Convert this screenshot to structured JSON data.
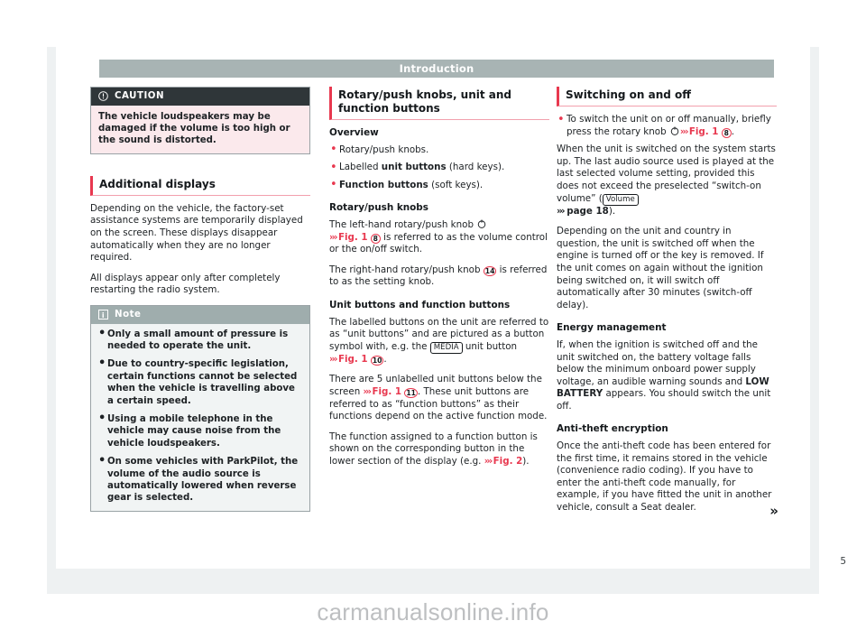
{
  "page": {
    "header_title": "Introduction",
    "page_number": "5",
    "watermark": "carmanualsonline.info"
  },
  "column_left": {
    "caution": {
      "icon": "exclamation-circle-icon",
      "label": "CAUTION",
      "text": "The vehicle loudspeakers may be damaged if the volume is too high or the sound is distorted."
    },
    "section": {
      "heading": "Additional displays",
      "paragraph_1": "Depending on the vehicle, the factory-set assistance systems are temporarily displayed on the screen. These displays disappear automatically when they are no longer required.",
      "paragraph_2": "All displays appear only after completely restarting the radio system."
    },
    "note": {
      "icon": "info-icon",
      "label": "Note",
      "items": [
        "Only a small amount of pressure is needed to operate the unit.",
        "Due to country-specific legislation, certain functions cannot be selected when the vehicle is travelling above a certain speed.",
        "Using a mobile telephone in the vehicle may cause noise from the vehicle loudspeakers.",
        "On some vehicles with ParkPilot, the volume of the audio source is automatically lowered when reverse gear is selected."
      ]
    }
  },
  "column_middle": {
    "heading": "Rotary/push knobs, unit and function buttons",
    "overview": {
      "subheading": "Overview",
      "bullet_1": "Rotary/push knobs.",
      "bullet_2_pre": "Labelled ",
      "bullet_2_bold": "unit buttons",
      "bullet_2_post": " (hard keys).",
      "bullet_3_bold": "Function buttons",
      "bullet_3_post": " (soft keys)."
    },
    "knobs": {
      "subheading": "Rotary/push knobs",
      "p1_a": "The left-hand rotary/push knob ",
      "p1_icon": "rotary-knob-icon",
      "p1_ref": "Fig. 1",
      "p1_callout": "8",
      "p1_b": " is referred to as the volume control or the on/off switch.",
      "p2_a": "The right-hand rotary/push knob ",
      "p2_callout": "14",
      "p2_b": " is referred to as the setting knob."
    },
    "buttons": {
      "subheading": "Unit buttons and function buttons",
      "p1_a": "The labelled buttons on the unit are referred to as “unit buttons” and are pictured as a button symbol with, e.g. the ",
      "p1_key": "MEDIA",
      "p1_b": " unit button ",
      "p1_ref": "Fig. 1",
      "p1_callout": "10",
      "p1_c": ".",
      "p2_a": "There are 5 unlabelled unit buttons below the screen ",
      "p2_ref": "Fig. 1",
      "p2_callout": "11",
      "p2_b": ". These unit buttons are referred to as “function buttons” as their functions depend on the active function mode.",
      "p3_a": "The function assigned to a function button is shown on the corresponding button in the lower section of the display (e.g. ",
      "p3_ref": "Fig. 2",
      "p3_b": ")."
    }
  },
  "column_right": {
    "heading": "Switching on and off",
    "bullet": {
      "a": "To switch the unit on or off manually, briefly press the rotary knob ",
      "icon": "rotary-knob-icon",
      "ref": "Fig. 1",
      "callout": "8",
      "b": "."
    },
    "startup": {
      "a": "When the unit is switched on the system starts up. The last audio source used is played at the last selected volume setting, provided this does not exceed the preselected “switch-on volume” (",
      "key": "Volume",
      "ref": "page 18",
      "b": ")."
    },
    "switch_off": "Depending on the unit and country in question, the unit is switched off when the engine is turned off or the key is removed. If the unit comes on again without the ignition being switched on, it will switch off automatically after 30 minutes (switch-off delay).",
    "energy": {
      "subheading": "Energy management",
      "a": "If, when the ignition is switched off and the unit switched on, the battery voltage falls below the minimum onboard power supply voltage, an audible warning sounds and ",
      "bold": "LOW BATTERY",
      "b": " appears. You should switch the unit off."
    },
    "antitheft": {
      "subheading": "Anti-theft encryption",
      "text": "Once the anti-theft code has been entered for the first time, it remains stored in the vehicle (convenience radio coding). If you have to enter the anti-theft code manually, for example, if you have fitted the unit in another vehicle, consult a Seat dealer."
    },
    "continued_arrow": "»"
  }
}
